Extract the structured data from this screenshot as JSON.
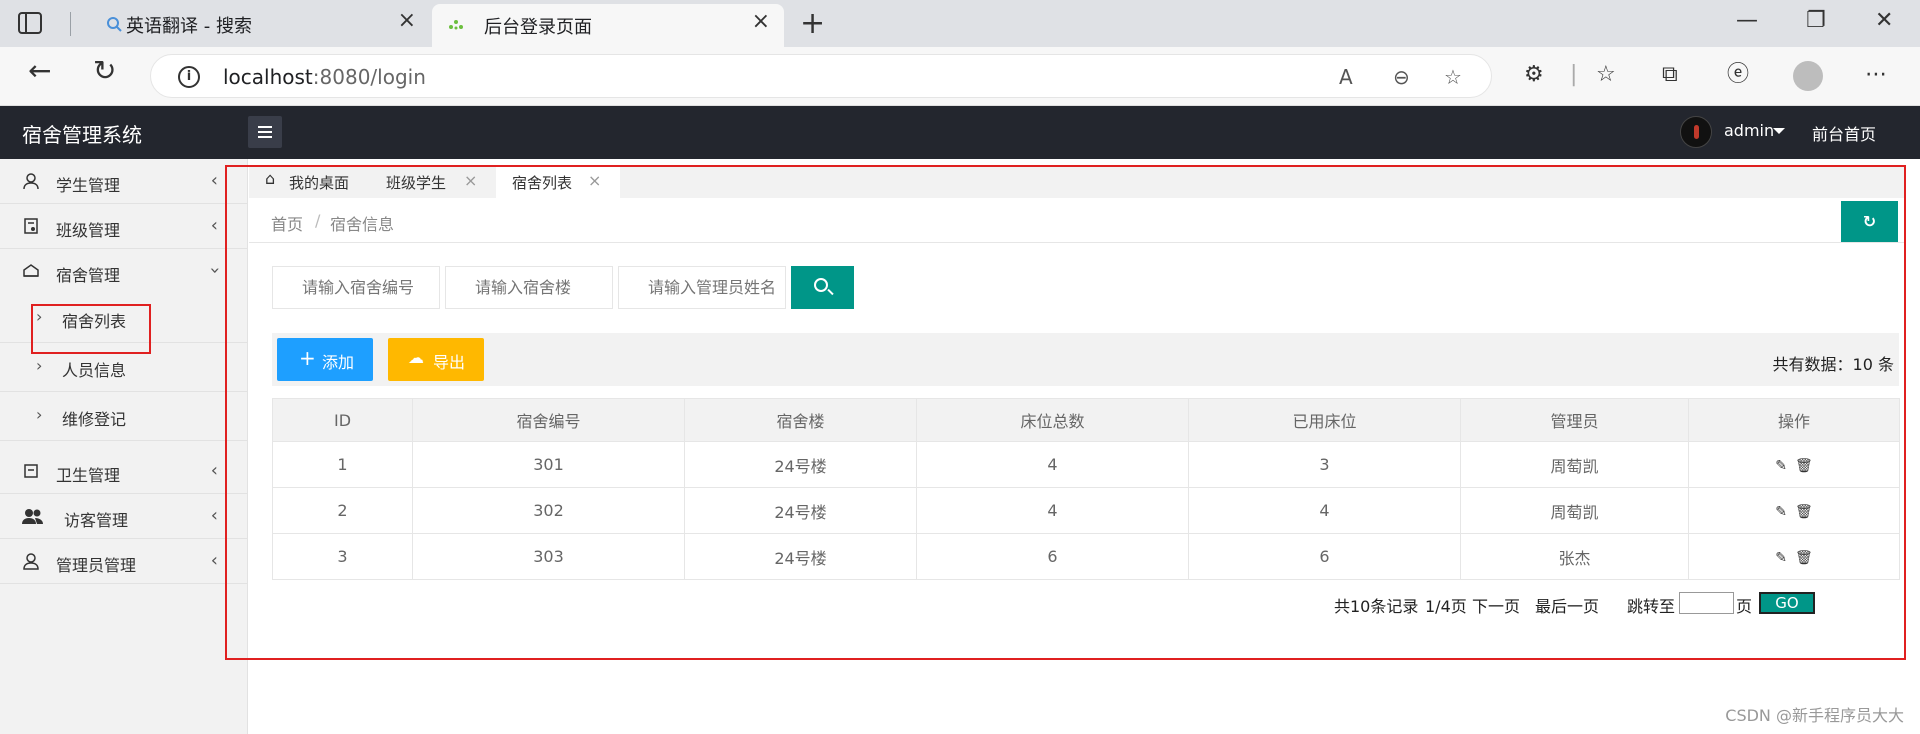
{
  "browser": {
    "tabs": [
      {
        "title": "英语翻译 - 搜索",
        "active": false
      },
      {
        "title": "后台登录页面",
        "active": true
      }
    ],
    "url_host": "localhost",
    "url_rest": ":8080/login",
    "new_tab": "+",
    "win_min": "—",
    "win_max": "❐",
    "win_close": "✕"
  },
  "app": {
    "title": "宿舍管理系统",
    "user": "admin",
    "front_link": "前台首页"
  },
  "sidebar": {
    "items": [
      {
        "label": "学生管理",
        "expanded": false
      },
      {
        "label": "班级管理",
        "expanded": false
      },
      {
        "label": "宿舍管理",
        "expanded": true
      },
      {
        "label": "卫生管理",
        "expanded": false
      },
      {
        "label": "访客管理",
        "expanded": false
      },
      {
        "label": "管理员管理",
        "expanded": false
      }
    ],
    "subitems": [
      {
        "label": "宿舍列表"
      },
      {
        "label": "人员信息"
      },
      {
        "label": "维修登记"
      }
    ]
  },
  "page_tabs": [
    {
      "label": "我的桌面"
    },
    {
      "label": "班级学生"
    },
    {
      "label": "宿舍列表"
    }
  ],
  "breadcrumb": {
    "home": "首页",
    "sep": "/",
    "current": "宿舍信息"
  },
  "search": {
    "dorm_no_placeholder": "请输入宿舍编号",
    "building_placeholder": "请输入宿舍楼",
    "manager_placeholder": "请输入管理员姓名"
  },
  "toolbar": {
    "add_label": "添加",
    "export_label": "导出",
    "total_label": "共有数据：10 条"
  },
  "table": {
    "headers": [
      "ID",
      "宿舍编号",
      "宿舍楼",
      "床位总数",
      "已用床位",
      "管理员",
      "操作"
    ],
    "rows": [
      [
        "1",
        "301",
        "24号楼",
        "4",
        "3",
        "周萄凯"
      ],
      [
        "2",
        "302",
        "24号楼",
        "4",
        "4",
        "周萄凯"
      ],
      [
        "3",
        "303",
        "24号楼",
        "6",
        "6",
        "张杰"
      ]
    ]
  },
  "pager": {
    "records": "共10条记录",
    "page_info": "1/4页",
    "next": "下一页",
    "last": "最后一页",
    "jump_to": "跳转至",
    "page_unit": "页",
    "go": "GO"
  },
  "watermark": "CSDN @新手程序员大大",
  "colors": {
    "header_bg": "#23262e",
    "primary": "#009688",
    "add_btn": "#1e9fff",
    "export_btn": "#ffb800",
    "annotation": "#e02020"
  }
}
